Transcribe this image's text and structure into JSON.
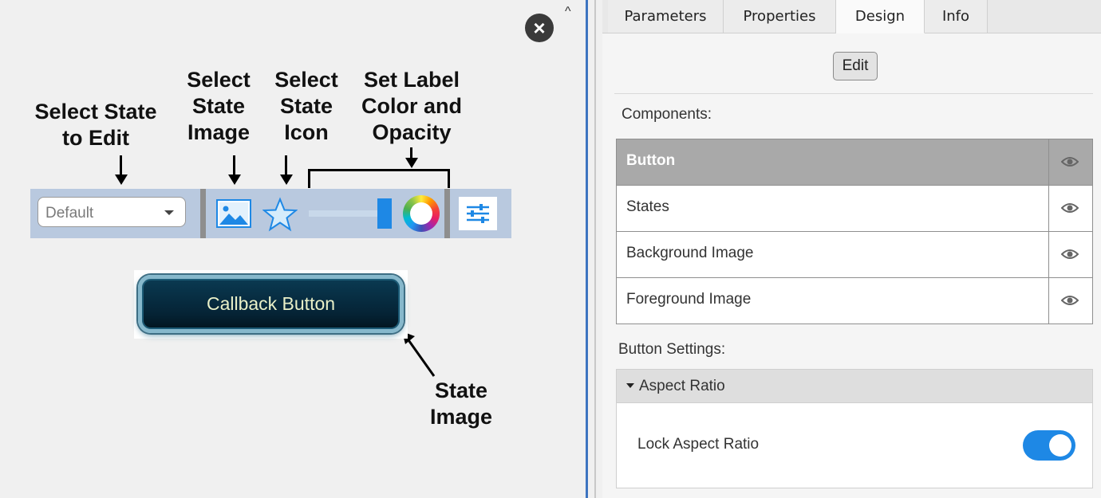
{
  "canvas": {
    "annotations": {
      "select_state": "Select State\nto Edit",
      "select_image": "Select\nState\nImage",
      "select_icon": "Select\nState\nIcon",
      "set_label": "Set Label\nColor and\nOpacity",
      "state_image": "State\nImage"
    },
    "toolbar": {
      "state_select_value": "Default",
      "opacity_level_fraction": 0.95
    },
    "callback_button_label": "Callback Button",
    "colors": {
      "toolbar_bg": "#b9c9df",
      "accent": "#1e88e5",
      "button_text": "#e9f0c8"
    }
  },
  "window": {
    "close_icon": "×",
    "collapse_icon": "^"
  },
  "panel": {
    "tabs": [
      {
        "label": "Parameters",
        "active": false
      },
      {
        "label": "Properties",
        "active": false
      },
      {
        "label": "Design",
        "active": true
      },
      {
        "label": "Info",
        "active": false
      }
    ],
    "edit_button": "Edit",
    "components_label": "Components:",
    "components": [
      {
        "name": "Button",
        "selected": true,
        "icon": "eye-icon"
      },
      {
        "name": "States",
        "selected": false,
        "icon": "eye-icon"
      },
      {
        "name": "Background Image",
        "selected": false,
        "icon": "eye-icon"
      },
      {
        "name": "Foreground Image",
        "selected": false,
        "icon": "eye-icon"
      }
    ],
    "button_settings_label": "Button Settings:",
    "aspect_section": {
      "header": "Aspect Ratio",
      "lock_label": "Lock Aspect Ratio",
      "lock_enabled": true
    }
  }
}
